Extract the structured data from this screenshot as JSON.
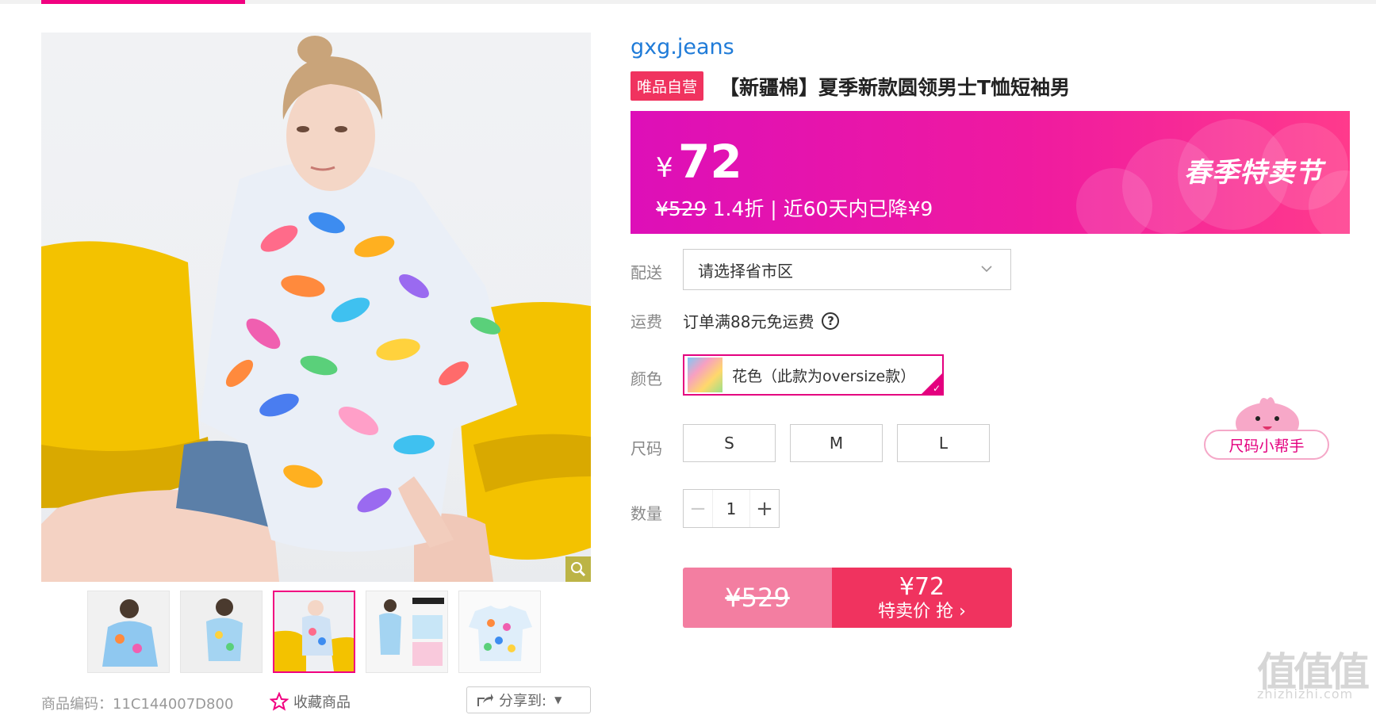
{
  "brand": "gxg.jeans",
  "badge": "唯品自营",
  "title": "【新疆棉】夏季新款圆领男士T恤短袖男",
  "price": {
    "currency": "¥",
    "current": "72",
    "original": "¥529",
    "discount_text": "1.4折 | 近60天内已降¥9",
    "festival": "春季特卖节"
  },
  "labels": {
    "delivery": "配送",
    "shipping": "运费",
    "color": "颜色",
    "size": "尺码",
    "quantity": "数量"
  },
  "delivery_select": {
    "value": "请选择省市区"
  },
  "shipping_text": "订单满88元免运费",
  "color_option": "花色（此款为oversize款）",
  "sizes": [
    "S",
    "M",
    "L"
  ],
  "quantity": "1",
  "buy_button": {
    "original": "¥529",
    "price": "¥72",
    "label": "特卖价 抢 ›"
  },
  "size_helper": "尺码小帮手",
  "meta": {
    "code": "商品编码：11C144007D800",
    "favorite": "收藏商品",
    "share": "分享到:"
  },
  "watermark": {
    "big": "值值值",
    "small": "zhizhizhi.com"
  },
  "colors": {
    "accent": "#f10180",
    "badge": "#f0335f",
    "brand_link": "#1f7bd8"
  }
}
